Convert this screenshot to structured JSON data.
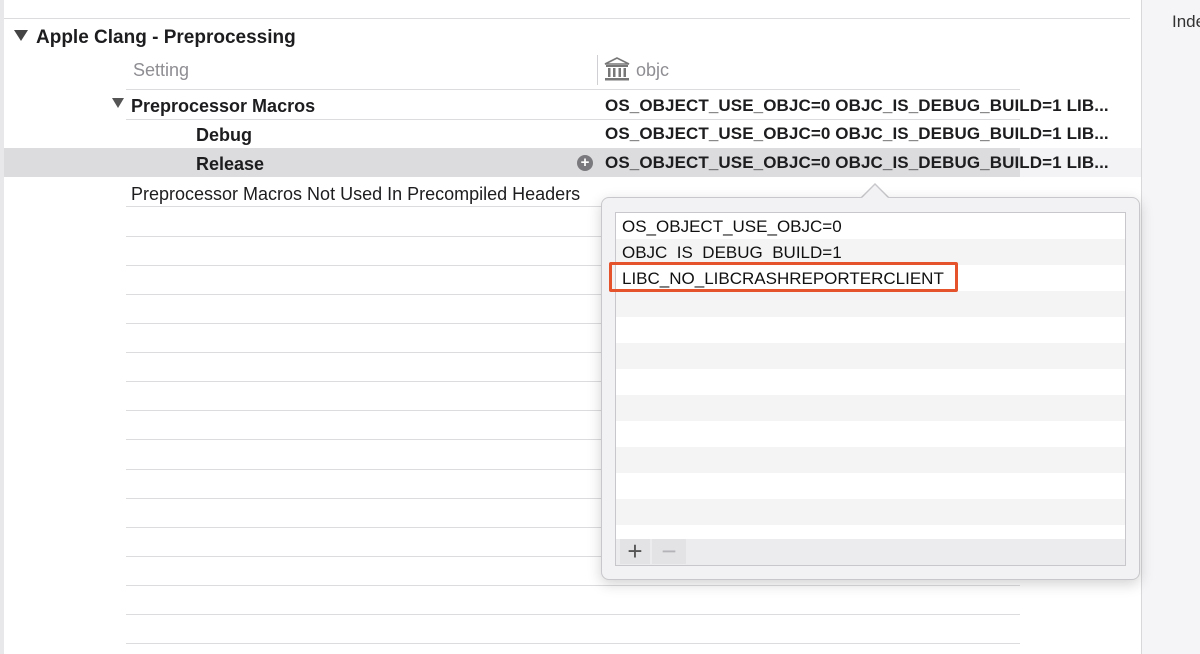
{
  "section": {
    "title": "Apple Clang - Preprocessing"
  },
  "columns": {
    "setting": "Setting",
    "target": "objc",
    "target_icon": "target-library-icon"
  },
  "rows": {
    "preprocessor_macros": {
      "label": "Preprocessor Macros",
      "value": "OS_OBJECT_USE_OBJC=0 OBJC_IS_DEBUG_BUILD=1 LIB..."
    },
    "debug": {
      "label": "Debug",
      "value": "OS_OBJECT_USE_OBJC=0 OBJC_IS_DEBUG_BUILD=1 LIB..."
    },
    "release": {
      "label": "Release",
      "value": "OS_OBJECT_USE_OBJC=0 OBJC_IS_DEBUG_BUILD=1 LIB..."
    },
    "not_used": {
      "label": "Preprocessor Macros Not Used In Precompiled Headers"
    }
  },
  "popover": {
    "macros": [
      "OS_OBJECT_USE_OBJC=0",
      "OBJC_IS_DEBUG_BUILD=1",
      "LIBC_NO_LIBCRASHREPORTERCLIENT"
    ],
    "add_label": "+",
    "remove_label": "−",
    "highlight_color": "#e4532b"
  },
  "inspector": {
    "label": "Inde"
  }
}
